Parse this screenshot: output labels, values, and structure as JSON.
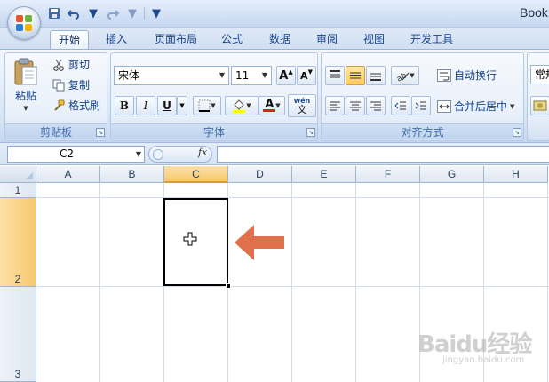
{
  "window": {
    "title": "Book"
  },
  "quick_access": {
    "icons": [
      "save-icon",
      "undo-icon",
      "redo-icon",
      "customize-icon"
    ]
  },
  "tabs": [
    {
      "label": "开始",
      "active": true
    },
    {
      "label": "插入"
    },
    {
      "label": "页面布局"
    },
    {
      "label": "公式"
    },
    {
      "label": "数据"
    },
    {
      "label": "审阅"
    },
    {
      "label": "视图"
    },
    {
      "label": "开发工具"
    }
  ],
  "ribbon": {
    "clipboard": {
      "label": "剪贴板",
      "paste": "粘贴",
      "cut": "剪切",
      "copy": "复制",
      "format_painter": "格式刷"
    },
    "font": {
      "label": "字体",
      "font_name": "宋体",
      "font_size": "11",
      "bold": "B",
      "italic": "I",
      "underline": "U",
      "grow": "A",
      "shrink": "A",
      "phonetic_top": "wén",
      "phonetic_bottom": "文",
      "font_color_sample": "A"
    },
    "alignment": {
      "label": "对齐方式",
      "wrap_text": "自动换行",
      "merge_center": "合并后居中"
    },
    "number": {
      "format": "常规"
    }
  },
  "formula_bar": {
    "name_box": "C2",
    "fx_label": "fx",
    "formula": ""
  },
  "sheet": {
    "columns": [
      "A",
      "B",
      "C",
      "D",
      "E",
      "F",
      "G",
      "H"
    ],
    "rows": [
      "1",
      "2",
      "3"
    ],
    "selected_column": "C",
    "selected_row": "2",
    "active_cell": "C2"
  },
  "colors": {
    "accent_arrow": "#e0704a",
    "selection_header": "#f8c96e",
    "ribbon_text": "#15428b"
  },
  "watermark": {
    "brand": "Baidu经验",
    "url": "jingyan.baidu.com"
  }
}
